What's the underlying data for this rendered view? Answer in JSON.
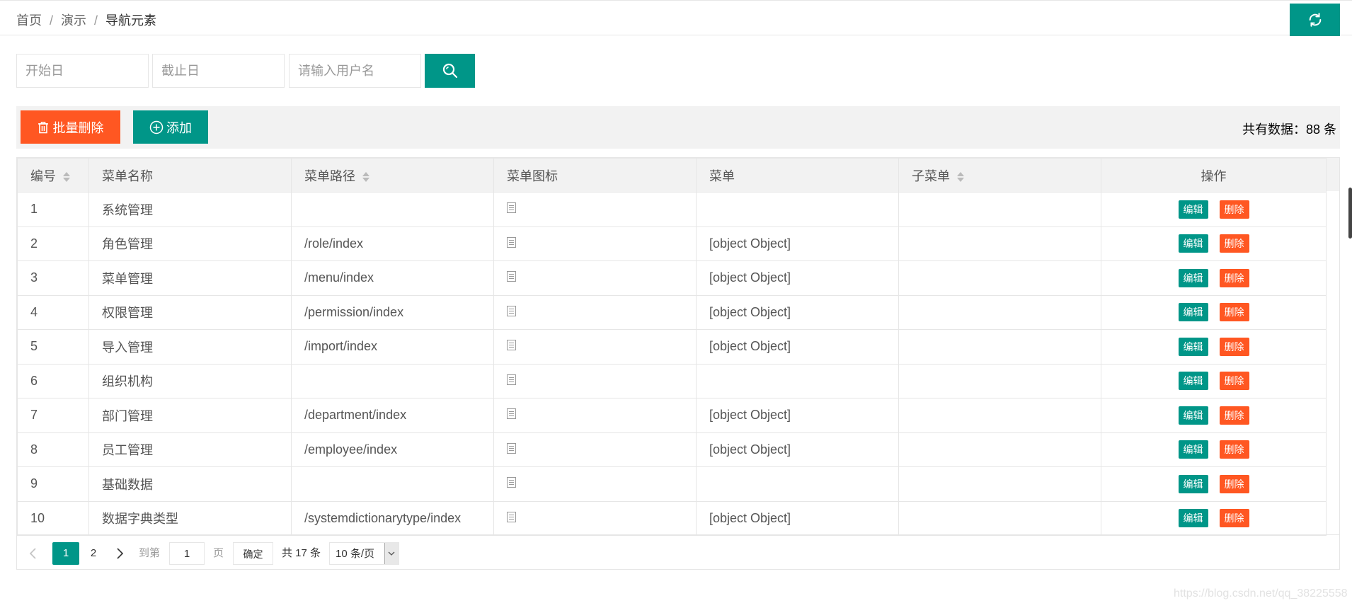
{
  "breadcrumb": {
    "items": [
      "首页",
      "演示",
      "导航元素"
    ],
    "sep": "/"
  },
  "search": {
    "start_placeholder": "开始日",
    "end_placeholder": "截止日",
    "username_placeholder": "请输入用户名"
  },
  "toolbar": {
    "batch_delete_label": "批量删除",
    "add_label": "添加",
    "total_text": "共有数据：88 条"
  },
  "colors": {
    "primary": "#009688",
    "danger": "#ff5722"
  },
  "table": {
    "columns": [
      "编号",
      "菜单名称",
      "菜单路径",
      "菜单图标",
      "菜单",
      "子菜单",
      "操作"
    ],
    "sortable": [
      true,
      false,
      true,
      false,
      false,
      true,
      false
    ],
    "rows": [
      {
        "id": "1",
        "name": "系统管理",
        "path": "",
        "menu": ""
      },
      {
        "id": "2",
        "name": "角色管理",
        "path": "/role/index",
        "menu": "[object Object]"
      },
      {
        "id": "3",
        "name": "菜单管理",
        "path": "/menu/index",
        "menu": "[object Object]"
      },
      {
        "id": "4",
        "name": "权限管理",
        "path": "/permission/index",
        "menu": "[object Object]"
      },
      {
        "id": "5",
        "name": "导入管理",
        "path": "/import/index",
        "menu": "[object Object]"
      },
      {
        "id": "6",
        "name": "组织机构",
        "path": "",
        "menu": ""
      },
      {
        "id": "7",
        "name": "部门管理",
        "path": "/department/index",
        "menu": "[object Object]"
      },
      {
        "id": "8",
        "name": "员工管理",
        "path": "/employee/index",
        "menu": "[object Object]"
      },
      {
        "id": "9",
        "name": "基础数据",
        "path": "",
        "menu": ""
      },
      {
        "id": "10",
        "name": "数据字典类型",
        "path": "/systemdictionarytype/index",
        "menu": "[object Object]"
      }
    ],
    "edit_label": "编辑",
    "delete_label": "删除"
  },
  "pagination": {
    "pages": [
      "1",
      "2"
    ],
    "current_page": "1",
    "goto_label": "到第",
    "goto_value": "1",
    "page_unit": "页",
    "confirm_label": "确定",
    "total_text": "共 17 条",
    "page_size": "10 条/页"
  },
  "watermark": "https://blog.csdn.net/qq_38225558"
}
